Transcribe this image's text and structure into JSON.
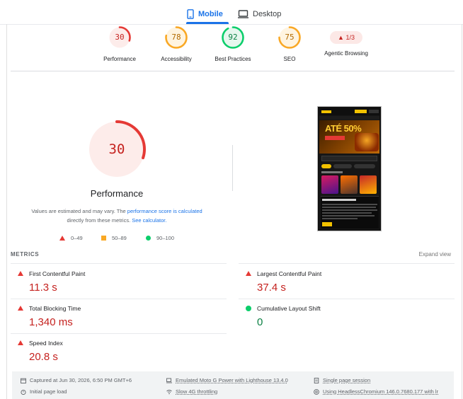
{
  "tabs": [
    {
      "label": "Mobile",
      "active": true
    },
    {
      "label": "Desktop",
      "active": false
    }
  ],
  "categories": [
    {
      "label": "Performance",
      "score": "30",
      "value": 30,
      "color": "#e53935",
      "fill": "#fdecea",
      "text_color": "#c5221f"
    },
    {
      "label": "Accessibility",
      "score": "78",
      "value": 78,
      "color": "#f9a825",
      "fill": "#fff4e0",
      "text_color": "#b26a00"
    },
    {
      "label": "Best Practices",
      "score": "92",
      "value": 92,
      "color": "#0cce6b",
      "fill": "#e6f7ee",
      "text_color": "#0b8043"
    },
    {
      "label": "SEO",
      "score": "75",
      "value": 75,
      "color": "#f9a825",
      "fill": "#fff4e0",
      "text_color": "#b26a00"
    }
  ],
  "agentic": {
    "label": "Agentic Browsing",
    "badge": "▲ 1/3"
  },
  "main_gauge": {
    "score": "30",
    "value": 30,
    "title": "Performance"
  },
  "estimate": {
    "text_before": "Values are estimated and may vary. The ",
    "link1": "performance score is calculated",
    "text_middle": " directly from these metrics. ",
    "link2": "See calculator."
  },
  "legend": [
    {
      "range": "0–49"
    },
    {
      "range": "50–89"
    },
    {
      "range": "90–100"
    }
  ],
  "metrics_section": {
    "heading": "METRICS",
    "expand": "Expand view"
  },
  "metrics": [
    {
      "name": "First Contentful Paint",
      "value": "11.3 s",
      "status": "poor"
    },
    {
      "name": "Largest Contentful Paint",
      "value": "37.4 s",
      "status": "poor"
    },
    {
      "name": "Total Blocking Time",
      "value": "1,340 ms",
      "status": "poor"
    },
    {
      "name": "Cumulative Layout Shift",
      "value": "0",
      "status": "good"
    },
    {
      "name": "Speed Index",
      "value": "20.8 s",
      "status": "poor"
    }
  ],
  "screenshot": {
    "banner_text": "ATÉ 50%"
  },
  "footer": {
    "captured": "Captured at Jun 30, 2026, 6:50 PM GMT+6",
    "initial_load": "Initial page load",
    "emulated": "Emulated Moto G Power with Lighthouse 13.4.0",
    "throttling": "Slow 4G throttling",
    "session": "Single page session",
    "browser": "Using HeadlessChromium 146.0.7680.177 with lr"
  }
}
